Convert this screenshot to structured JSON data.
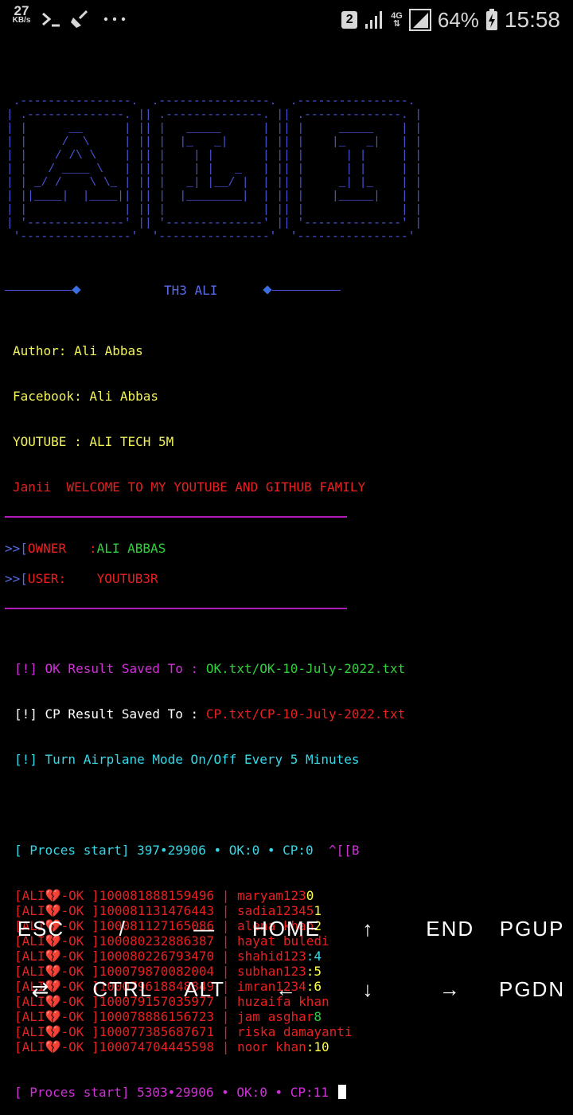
{
  "status_bar": {
    "net_speed": "27",
    "net_speed_unit": "KB/s",
    "sim_slot": "2",
    "network_type": "4G",
    "battery_percent": "64%",
    "time": "15:58"
  },
  "banner": {
    "ascii_a": " .----------------.\n| .--------------. |\n| |      __      | |\n| |     /  \\     | |\n| |    / /\\ \\    | |\n| |   / ____ \\   | |\n| | _/ /    \\ \\_ | |\n| ||____|  |____|| |\n| |              | |\n| '--------------' |\n '----------------' ",
    "ascii_l": " .----------------.\n| .--------------. |\n| |   _____      | |\n| |  |_   _|     | |\n| |    | |       | |\n| |    | |   _   | |\n| |   _| |__/ |  | |\n| |  |________|  | |\n| |              | |\n| '--------------' |\n '----------------' ",
    "ascii_i": " .----------------.\n| .--------------. |\n| |     _____    | |\n| |    |_   _|   | |\n| |      | |     | |\n| |      | |     | |\n| |     _| |_    | |\n| |    |_____|   | |\n| |              | |\n| '--------------' |\n '----------------' ",
    "tag": "TH3 ALI"
  },
  "info": {
    "author": "Author: Ali Abbas",
    "facebook": "Facebook: Ali Abbas",
    "youtube": "YOUTUBE : ALI TECH 5M",
    "welcome": "Janii  WELCOME TO MY YOUTUBE AND GITHUB FAMILY"
  },
  "meta": {
    "owner_prefix": ">>[",
    "owner_label": "OWNER   :",
    "owner_value": "ALI ABBAS",
    "user_prefix": ">>[",
    "user_label": "USER:    ",
    "user_value": "YOUTUB3R"
  },
  "notices": {
    "ok_prefix": "[!] ",
    "ok_label": "OK Result Saved To : ",
    "ok_file": "OK.txt/OK-10-July-2022.txt",
    "cp_prefix": "[!] CP Result Saved To : ",
    "cp_file": "CP.txt/CP-10-July-2022.txt",
    "airplane": "[!] Turn Airplane Mode On/Off Every 5 Minutes"
  },
  "process": {
    "start_line": "[ Proces start] 397•29906 • OK:0 • CP:0  ",
    "escape_seq": "^[[B",
    "ok_tag": "[ALI💔-OK ]",
    "results": [
      {
        "uid": "100081888159496",
        "pass": "maryam123",
        "suffix": "0",
        "suffix_color": "bright-yellow"
      },
      {
        "uid": "100081131476443",
        "pass": "sadia12345",
        "suffix": "1",
        "suffix_color": "bright-yellow"
      },
      {
        "uid": "100081127165086",
        "pass": "alena khan",
        "suffix": "2",
        "suffix_color": "bright-yellow"
      },
      {
        "uid": "100080232886387",
        "pass": "hayat buledi",
        "suffix": "",
        "suffix_color": "bright-yellow"
      },
      {
        "uid": "100080226793470",
        "pass": "shahid123",
        "suffix": ":4",
        "suffix_color": "cyan"
      },
      {
        "uid": "100079870082004",
        "pass": "subhan123",
        "suffix": ":5",
        "suffix_color": "bright-yellow"
      },
      {
        "uid": "100079618848849",
        "pass": "imran1234",
        "suffix": ":6",
        "suffix_color": "bright-yellow"
      },
      {
        "uid": "100079157035977",
        "pass": "huzaifa khan",
        "suffix": "",
        "suffix_color": "bright-yellow"
      },
      {
        "uid": "100078886156723",
        "pass": "jam asghar",
        "suffix": "8",
        "suffix_color": "green"
      },
      {
        "uid": "100077385687671",
        "pass": "riska damayanti",
        "suffix": "",
        "suffix_color": "bright-yellow"
      },
      {
        "uid": "100074704445598",
        "pass": "noor khan",
        "suffix": ":10",
        "suffix_color": "bright-yellow"
      }
    ],
    "end_line": "[ Proces start] 5303•29906 • OK:0 • CP:11"
  },
  "extra_keys": {
    "row1": [
      "ESC",
      "/",
      "—",
      "HOME",
      "↑",
      "END",
      "PGUP"
    ],
    "row2": [
      "⇄",
      "CTRL",
      "ALT",
      "←",
      "↓",
      "→",
      "PGDN"
    ]
  },
  "colors": {
    "banner": "#4a55d8",
    "rule": "#b01ab8",
    "yellow": "#f2f25a",
    "red": "#e82020",
    "green": "#2ed13a",
    "cyan": "#36d8e8",
    "magenta": "#d030d8"
  }
}
